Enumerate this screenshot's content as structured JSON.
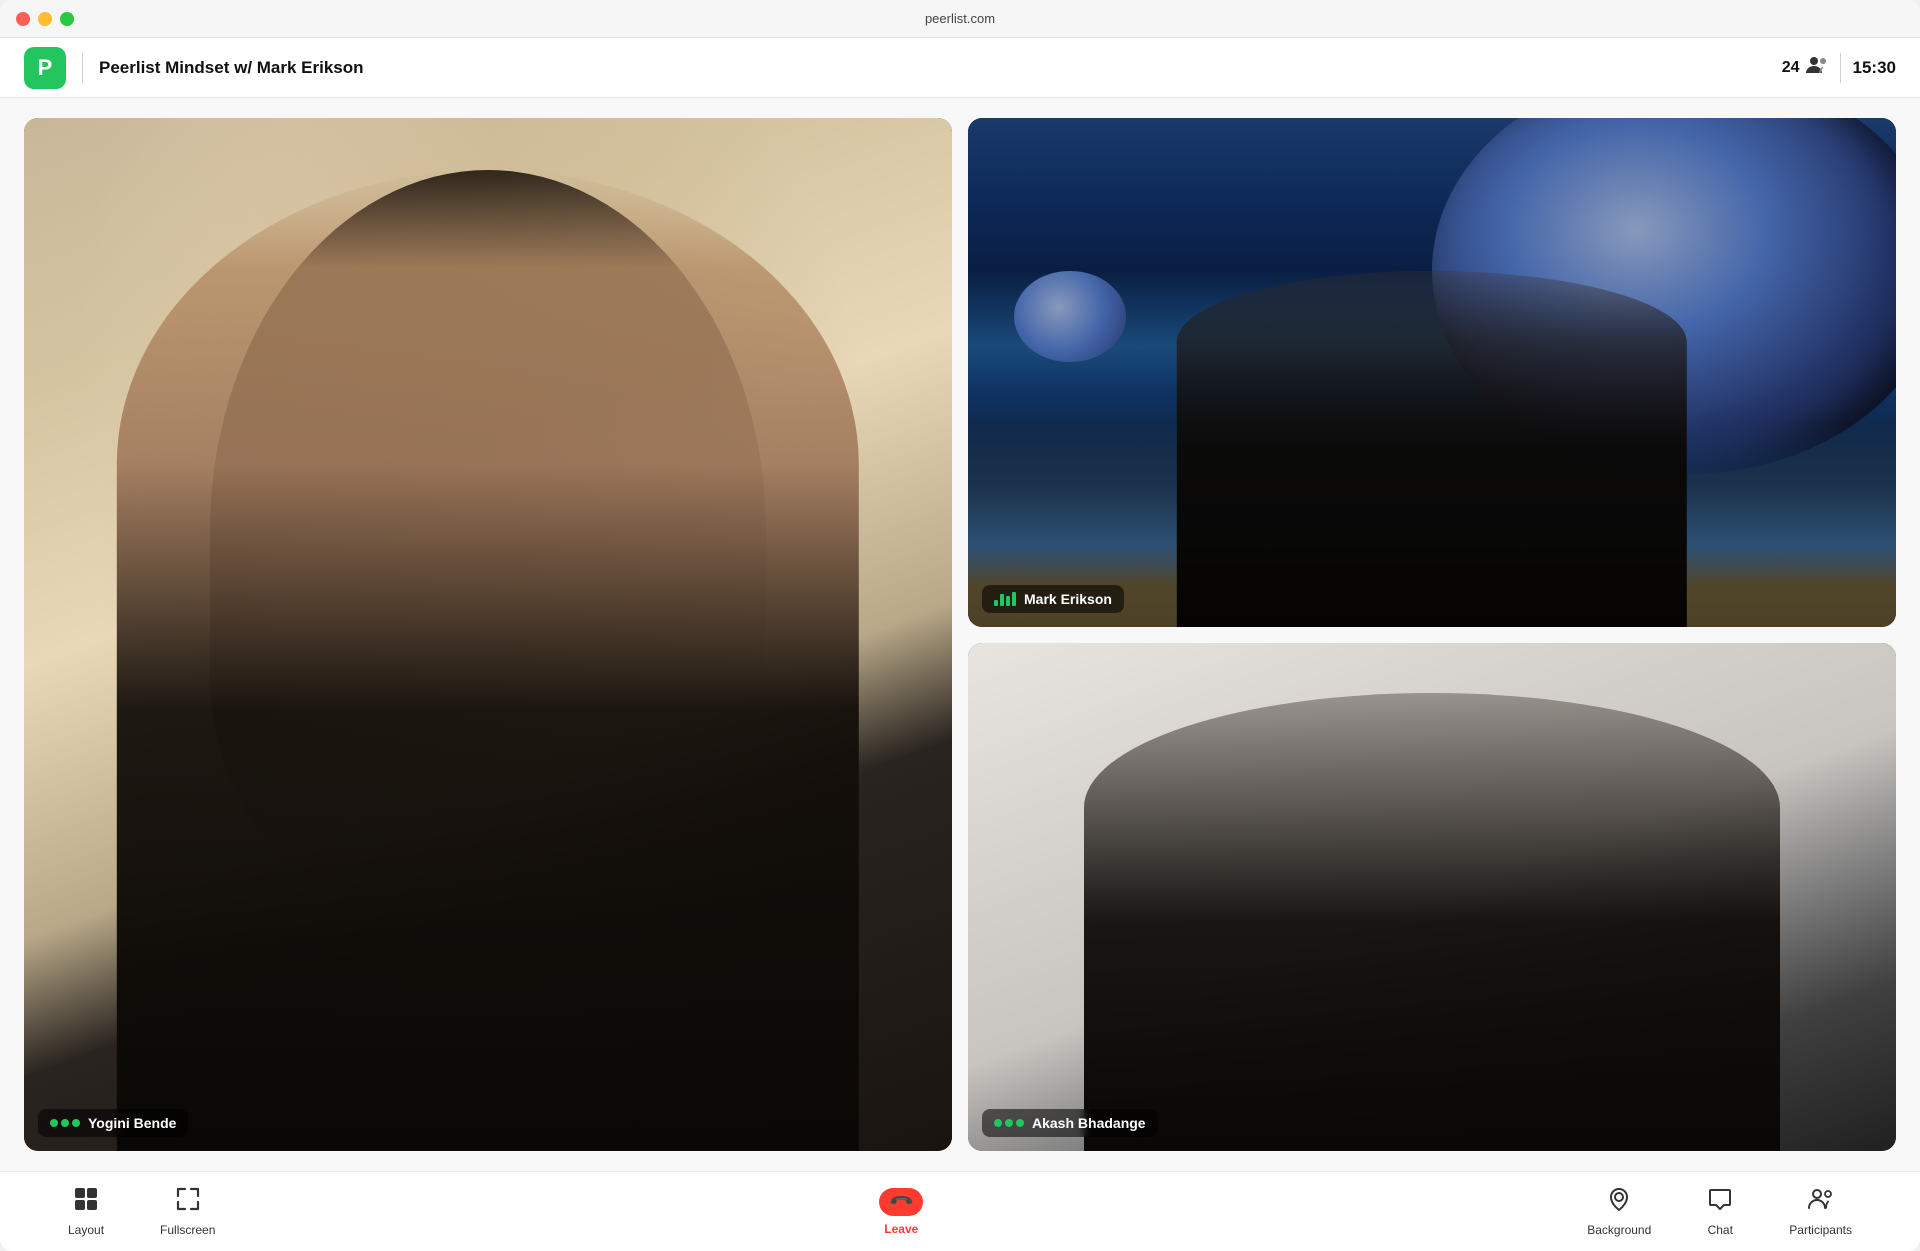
{
  "window": {
    "title": "peerlist.com"
  },
  "header": {
    "logo_letter": "P",
    "meeting_title": "Peerlist Mindset w/ Mark Erikson",
    "participant_count": "24",
    "time": "15:30"
  },
  "participants": [
    {
      "id": "yogini",
      "name": "Yogini Bende",
      "indicator": "dots",
      "position": "left"
    },
    {
      "id": "mark",
      "name": "Mark Erikson",
      "indicator": "bars",
      "position": "right-top"
    },
    {
      "id": "akash",
      "name": "Akash Bhadange",
      "indicator": "dots",
      "position": "right-bottom"
    }
  ],
  "toolbar": {
    "layout_label": "Layout",
    "fullscreen_label": "Fullscreen",
    "leave_label": "Leave",
    "background_label": "Background",
    "chat_label": "Chat",
    "participants_label": "Participants"
  }
}
